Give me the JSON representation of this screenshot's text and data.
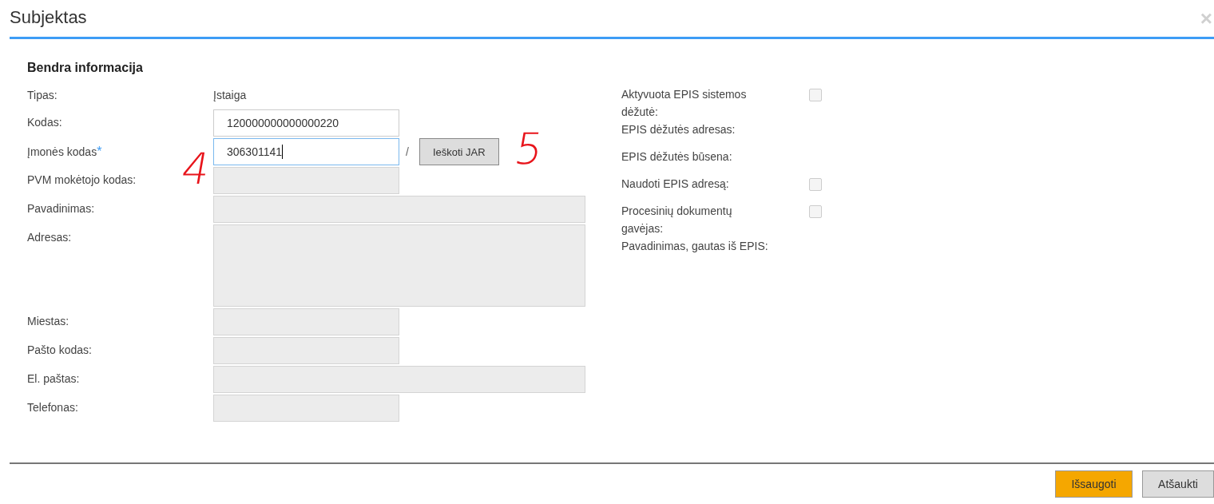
{
  "window": {
    "title": "Subjektas",
    "close": "×"
  },
  "section": {
    "title": "Bendra informacija"
  },
  "left_fields": [
    {
      "label": "Tipas:",
      "kind": "text",
      "value": "Įstaiga"
    },
    {
      "label": "Kodas:",
      "kind": "input",
      "value": "120000000000000220",
      "disabled": false,
      "focused": false
    },
    {
      "label": "Įmonės kodas",
      "required_mark": "*",
      "kind": "input",
      "value": "306301141",
      "disabled": false,
      "focused": true,
      "separator": "/",
      "button": "Ieškoti JAR"
    },
    {
      "label": "PVM mokėtojo kodas:",
      "kind": "input",
      "disabled": true,
      "focused": false
    },
    {
      "label": "Pavadinimas:",
      "kind": "wideinput",
      "disabled": true,
      "focused": false
    },
    {
      "label": "Adresas:",
      "kind": "textarea",
      "disabled": true,
      "focused": false
    },
    {
      "label": "Miestas:",
      "kind": "input",
      "disabled": true,
      "focused": false
    },
    {
      "label": "Pašto kodas:",
      "kind": "input",
      "disabled": true,
      "focused": false
    },
    {
      "label": "El. paštas:",
      "kind": "wideinput",
      "disabled": true,
      "focused": false
    },
    {
      "label": "Telefonas:",
      "kind": "input",
      "disabled": true,
      "focused": false
    }
  ],
  "right_fields": [
    {
      "label": "Aktyvuota EPIS sistemos dėžutė:",
      "kind": "checkbox",
      "checked": false
    },
    {
      "label": "EPIS dėžutės adresas:",
      "kind": "text"
    },
    {
      "label": "EPIS dėžutės būsena:",
      "kind": "text"
    },
    {
      "label": "Naudoti EPIS adresą:",
      "kind": "checkbox",
      "checked": false
    },
    {
      "label": "Procesinių dokumentų gavėjas:",
      "kind": "checkbox",
      "checked": false
    },
    {
      "label": "Pavadinimas, gautas iš EPIS:",
      "kind": "text"
    }
  ],
  "annotations": [
    "4",
    "5"
  ],
  "buttons": [
    {
      "label": "Išsaugoti",
      "kind": "primary"
    },
    {
      "label": "Atšaukti",
      "kind": "secondary"
    }
  ]
}
